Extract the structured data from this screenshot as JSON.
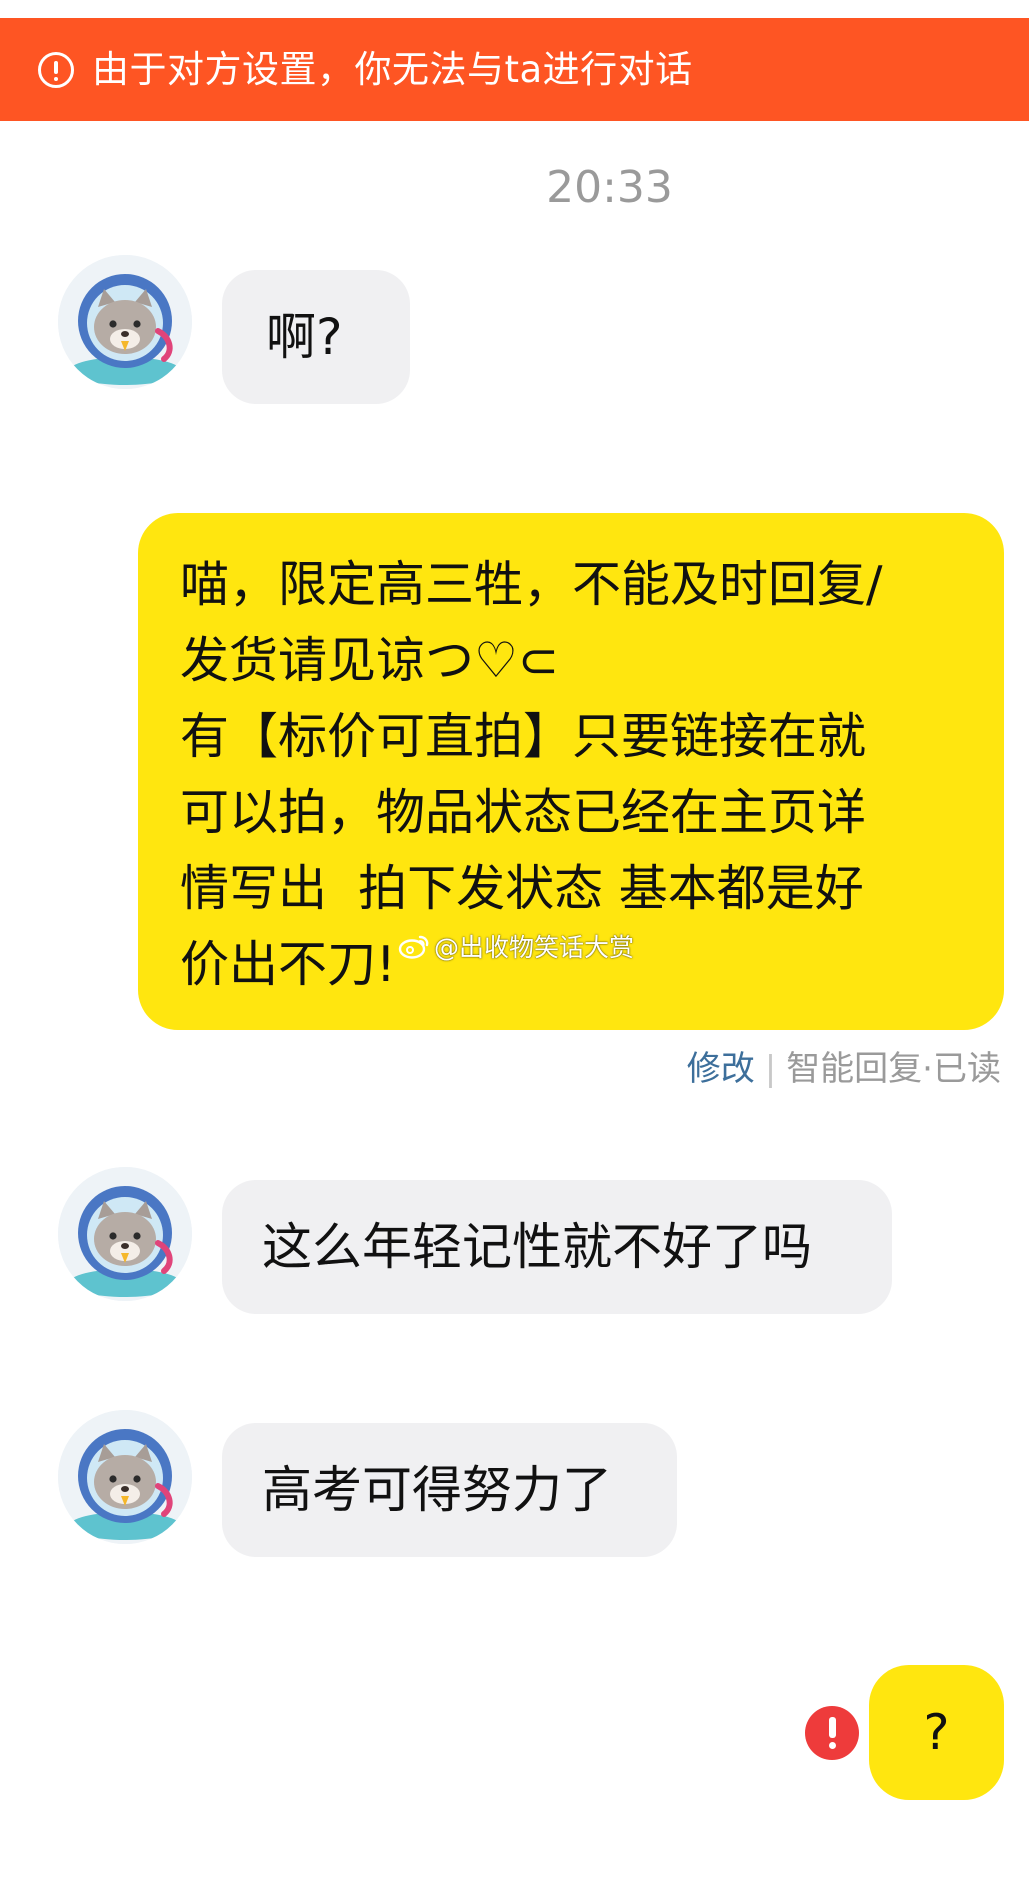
{
  "banner": {
    "icon": "alert-circle-icon",
    "text": "由于对方设置，你无法与ta进行对话",
    "color": "#fe5523"
  },
  "chat": {
    "timestamp": "20:33",
    "messages": [
      {
        "side": "incoming",
        "text": "啊?"
      },
      {
        "side": "outgoing",
        "text": "喵，限定高三牲，不能及时回复/\n发货请见谅つ♡⊂\n有【标价可直拍】只要链接在就\n可以拍，物品状态已经在主页详\n情写出  拍下发状态 基本都是好\n价出不刀!"
      },
      {
        "side": "incoming",
        "text": "这么年轻记性就不好了吗"
      },
      {
        "side": "incoming",
        "text": "高考可得努力了"
      },
      {
        "side": "outgoing",
        "text": "?",
        "status_icon": "send-failed-icon"
      }
    ],
    "message_meta": {
      "edit": "修改",
      "separator": "|",
      "status": "智能回复·已读"
    }
  },
  "watermark": {
    "icon": "weibo-icon",
    "text": "@出收物笑话大赏"
  },
  "colors": {
    "outgoing_bubble": "#ffe60f",
    "incoming_bubble": "#f0f0f2",
    "error": "#ee3b3b",
    "link": "#3d6f9b"
  }
}
